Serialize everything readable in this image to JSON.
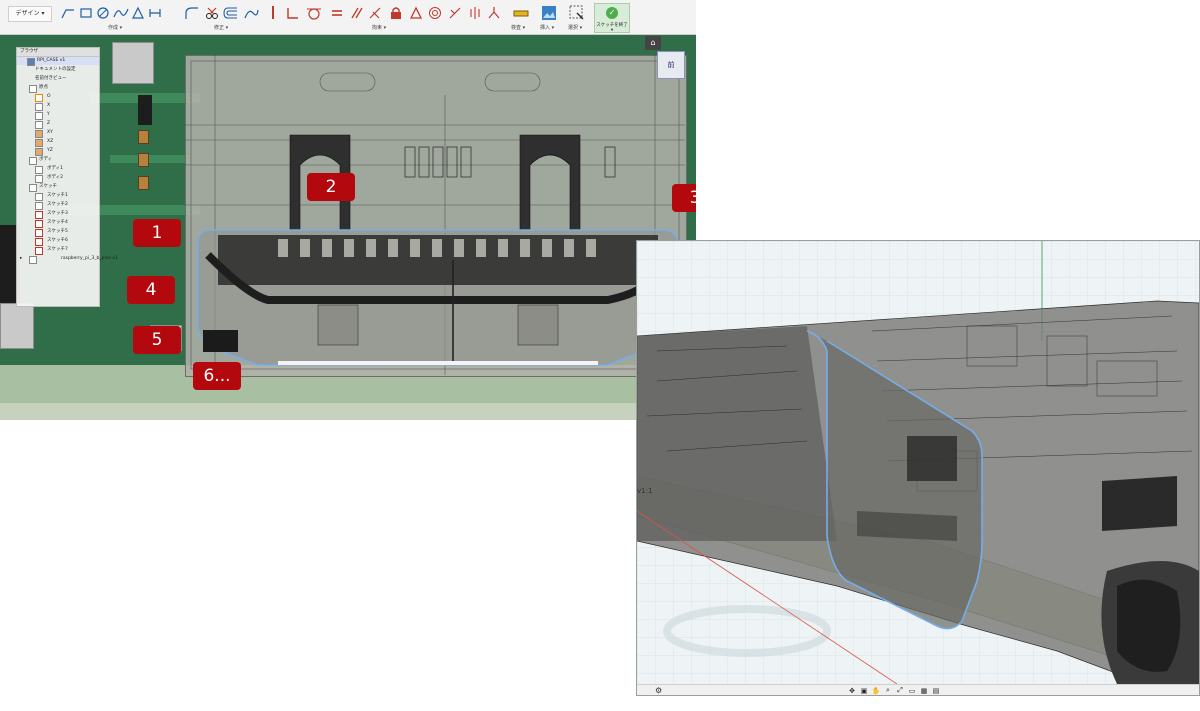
{
  "toolbar": {
    "workspace": "デザイン ▾",
    "groups": [
      {
        "label": "作成 ▾"
      },
      {
        "label": "修正 ▾"
      },
      {
        "label": "拘束 ▾"
      },
      {
        "label": "検査 ▾"
      },
      {
        "label": "挿入 ▾"
      },
      {
        "label": "選択 ▾"
      }
    ],
    "finish_sketch": "スケッチを終了 ▾",
    "icons": [
      "line-icon",
      "rectangle-icon",
      "circle-icon",
      "spline-icon",
      "polygon-icon",
      "slot-icon",
      "fillet-icon",
      "trim-icon",
      "offset-icon",
      "dimension-icon",
      "coincident-icon",
      "tangent-icon",
      "equal-icon",
      "parallel-icon",
      "perpendicular-icon",
      "lock-icon",
      "triangle-icon",
      "concentric-icon",
      "midpoint-icon",
      "symmetry-icon",
      "curvature-icon",
      "measure-icon",
      "image-icon",
      "select-icon",
      "check-icon"
    ]
  },
  "browser": {
    "title": "ブラウザ",
    "items": [
      {
        "label": "RPI_CASE v1"
      },
      {
        "label": "ドキュメントの設定"
      },
      {
        "label": "名前付きビュー"
      },
      {
        "label": "原点"
      },
      {
        "label": "O"
      },
      {
        "label": "X"
      },
      {
        "label": "Y"
      },
      {
        "label": "Z"
      },
      {
        "label": "XY"
      },
      {
        "label": "XZ"
      },
      {
        "label": "YZ"
      },
      {
        "label": "ボディ"
      },
      {
        "label": "ボディ1"
      },
      {
        "label": "ボディ2"
      },
      {
        "label": "スケッチ"
      },
      {
        "label": "スケッチ1"
      },
      {
        "label": "スケッチ2"
      },
      {
        "label": "スケッチ3"
      },
      {
        "label": "スケッチ4"
      },
      {
        "label": "スケッチ5"
      },
      {
        "label": "スケッチ6"
      },
      {
        "label": "スケッチ7"
      },
      {
        "label": "raspberry_pi_3_b_plus v1"
      }
    ]
  },
  "viewcube": {
    "face": "前",
    "home_icon": "home-icon"
  },
  "callouts": [
    "1",
    "2",
    "3",
    "4",
    "5",
    "6..."
  ],
  "inset": {
    "partial_label": "v1:1",
    "nav_icons": [
      "orbit-icon",
      "look-at-icon",
      "pan-icon",
      "zoom-icon",
      "fit-icon",
      "display-icon",
      "grid-icon",
      "viewports-icon"
    ]
  },
  "colors": {
    "callout": "#b3080e",
    "pcb": "#2f6e48",
    "sketch_profile": "#74aee8",
    "finish_sketch": "#4cae4c"
  }
}
